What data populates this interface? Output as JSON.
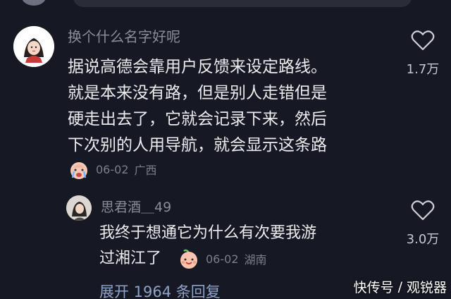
{
  "main_comment": {
    "username": "换个什么名字好呢",
    "text_lines": [
      "据说高德会靠用户反馈来设定路线。",
      "就是本来没有路，但是别人走错但是",
      "硬走出去了，它就会记录下来，然后",
      "下次别的人用导航，就会显示这条路"
    ],
    "emoji_icon": "crying-face-icon",
    "date": "06-02",
    "region": "广西",
    "likes": "1.7万"
  },
  "reply_comment": {
    "username": "思君酒＿49",
    "text_lines": [
      "我终于想通它为什么有次要我游",
      "过湘江了"
    ],
    "emoji_icon": "smiling-peach-face-icon",
    "date": "06-02",
    "region": "湖南",
    "likes": "3.0万"
  },
  "expand_replies": "展开 1964 条回复",
  "watermark": {
    "left": "快传号",
    "separator": "/",
    "right": "观锐器"
  },
  "colors": {
    "background": "#161823",
    "username": "#8a8c96",
    "comment_text": "#ececef",
    "meta": "#7d7f89",
    "expand_link": "#8fa2c8"
  }
}
